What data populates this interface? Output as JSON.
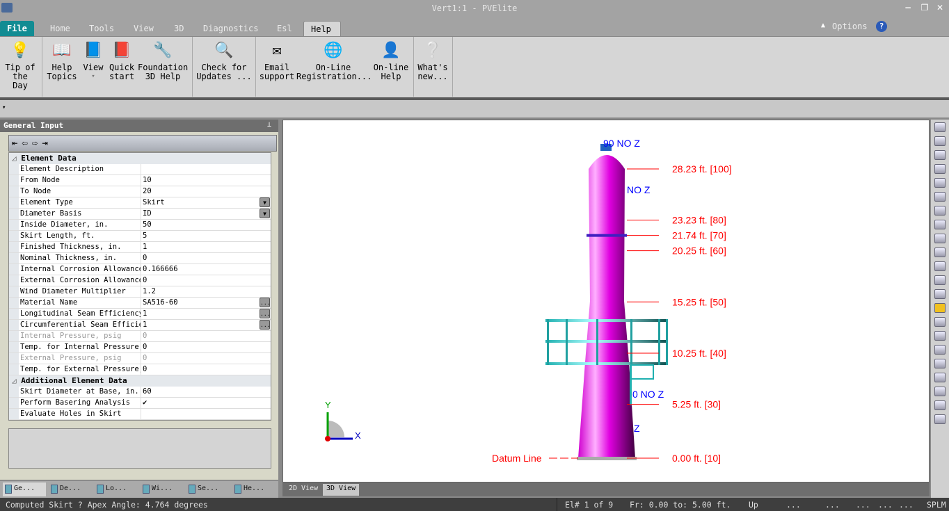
{
  "window": {
    "title": "Vert1:1 - PVElite"
  },
  "tabs": [
    {
      "label": "File"
    },
    {
      "label": "Home"
    },
    {
      "label": "Tools"
    },
    {
      "label": "View"
    },
    {
      "label": "3D"
    },
    {
      "label": "Diagnostics"
    },
    {
      "label": "Esl"
    },
    {
      "label": "Help"
    }
  ],
  "options": {
    "label": "Options"
  },
  "ribbon": [
    {
      "line1": "Tip of",
      "line2": "the Day",
      "icon": "lightbulb-icon"
    },
    {
      "line1": "Help",
      "line2": "Topics",
      "icon": "book-search-icon"
    },
    {
      "line1": "View",
      "line2": "▾",
      "icon": "book-user-icon"
    },
    {
      "line1": "Quick",
      "line2": "start",
      "icon": "book-lightning-icon"
    },
    {
      "line1": "Foundation",
      "line2": "3D Help",
      "icon": "book-wrench-icon"
    },
    {
      "line1": "Check for",
      "line2": "Updates ...",
      "icon": "magnifier-globe-icon"
    },
    {
      "line1": "Email",
      "line2": "support",
      "icon": "envelope-icon"
    },
    {
      "line1": "On-Line",
      "line2": "Registration...",
      "icon": "globe-pen-icon"
    },
    {
      "line1": "On-line",
      "line2": "Help",
      "icon": "person-monitor-icon"
    },
    {
      "line1": "What's",
      "line2": "new...",
      "icon": "window-question-icon"
    }
  ],
  "panel": {
    "title": "General Input",
    "categories": [
      {
        "name": "Element Data",
        "rows": [
          {
            "label": "Element Description",
            "value": ""
          },
          {
            "label": "From Node",
            "value": "10"
          },
          {
            "label": "To Node",
            "value": "20"
          },
          {
            "label": "Element Type",
            "value": "Skirt",
            "control": "dropdown"
          },
          {
            "label": "Diameter Basis",
            "value": "ID",
            "control": "dropdown"
          },
          {
            "label": "Inside Diameter, in.",
            "value": "50"
          },
          {
            "label": "Skirt Length, ft.",
            "value": "5"
          },
          {
            "label": "Finished Thickness, in.",
            "value": "1"
          },
          {
            "label": "Nominal Thickness, in.",
            "value": "0"
          },
          {
            "label": "Internal Corrosion Allowance,",
            "value": "0.166666"
          },
          {
            "label": "External Corrosion Allowance,",
            "value": "0"
          },
          {
            "label": "Wind Diameter Multiplier",
            "value": "1.2"
          },
          {
            "label": "Material Name",
            "value": "SA516-60",
            "control": "ellipsis"
          },
          {
            "label": "Longitudinal Seam Efficiency",
            "value": "1",
            "control": "ellipsis"
          },
          {
            "label": "Circumferential Seam Efficier",
            "value": "1",
            "control": "ellipsis"
          },
          {
            "label": "Internal Pressure, psig",
            "value": "0",
            "disabled": true
          },
          {
            "label": "Temp. for Internal Pressure,",
            "value": "0"
          },
          {
            "label": "External Pressure, psig",
            "value": "0",
            "disabled": true
          },
          {
            "label": "Temp. for External Pressure,",
            "value": "0"
          }
        ]
      },
      {
        "name": "Additional Element Data",
        "rows": [
          {
            "label": "Skirt Diameter at Base, in.",
            "value": "60"
          },
          {
            "label": "Perform Basering Analysis",
            "value": "✔"
          },
          {
            "label": "Evaluate Holes in Skirt",
            "value": ""
          }
        ]
      }
    ],
    "tabs": [
      "Ge...",
      "De...",
      "Lo...",
      "Wi...",
      "Se...",
      "He..."
    ]
  },
  "viewport": {
    "elevations": [
      {
        "text": "28.23 ft.  [100]",
        "ft": 28.23
      },
      {
        "text": "23.23 ft.  [80]",
        "ft": 23.23
      },
      {
        "text": "21.74 ft.  [70]",
        "ft": 21.74
      },
      {
        "text": "20.25 ft.  [60]",
        "ft": 20.25
      },
      {
        "text": "15.25 ft.  [50]",
        "ft": 15.25
      },
      {
        "text": "10.25 ft.  [40]",
        "ft": 10.25
      },
      {
        "text": "5.25 ft.  [30]",
        "ft": 5.25
      },
      {
        "text": "0.00 ft.  [10]",
        "ft": 0
      }
    ],
    "nozzle_labels": [
      "90 NO Z",
      "NO Z",
      "0 NO Z",
      "Z"
    ],
    "datum": "Datum Line",
    "axis": {
      "x": "X",
      "y": "Y"
    },
    "colors": {
      "vessel": "#e000e0",
      "platform": "#20c0c0",
      "labels": "#ff0000",
      "nozzles": "#0000ff"
    },
    "view_tabs": [
      "2D View",
      "3D View"
    ]
  },
  "status": {
    "message": "Computed Skirt ? Apex Angle:  4.764   degrees",
    "element": "El# 1 of 9",
    "range": "Fr: 0.00 to: 5.00 ft.",
    "direction": "Up",
    "dots": [
      "...",
      "...",
      "...",
      "...",
      "..."
    ],
    "units": "SPLM"
  }
}
